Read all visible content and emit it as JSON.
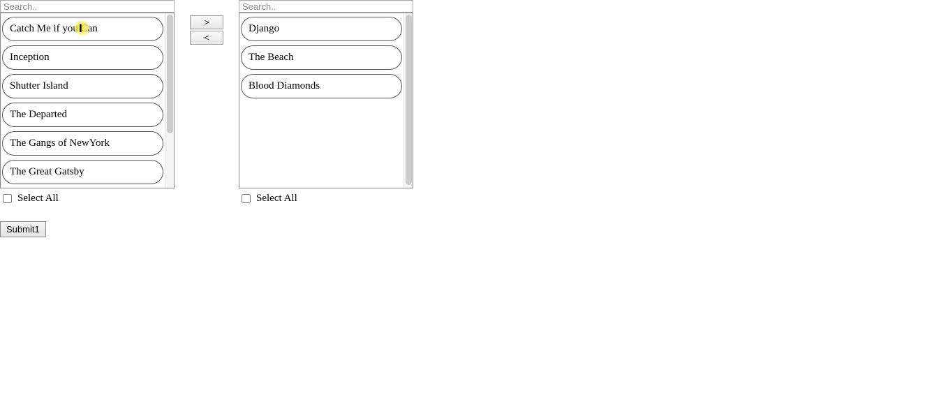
{
  "left": {
    "search_placeholder": "Search..",
    "items": [
      "Catch Me if you Can",
      "Inception",
      "Shutter Island",
      "The Departed",
      "The Gangs of NewYork",
      "The Great Gatsby"
    ],
    "select_all_label": "Select All"
  },
  "right": {
    "search_placeholder": "Search..",
    "items": [
      "Django",
      "The Beach",
      "Blood Diamonds"
    ],
    "select_all_label": "Select All"
  },
  "transfer": {
    "to_right": ">",
    "to_left": "<"
  },
  "submit_label": "Submit1"
}
